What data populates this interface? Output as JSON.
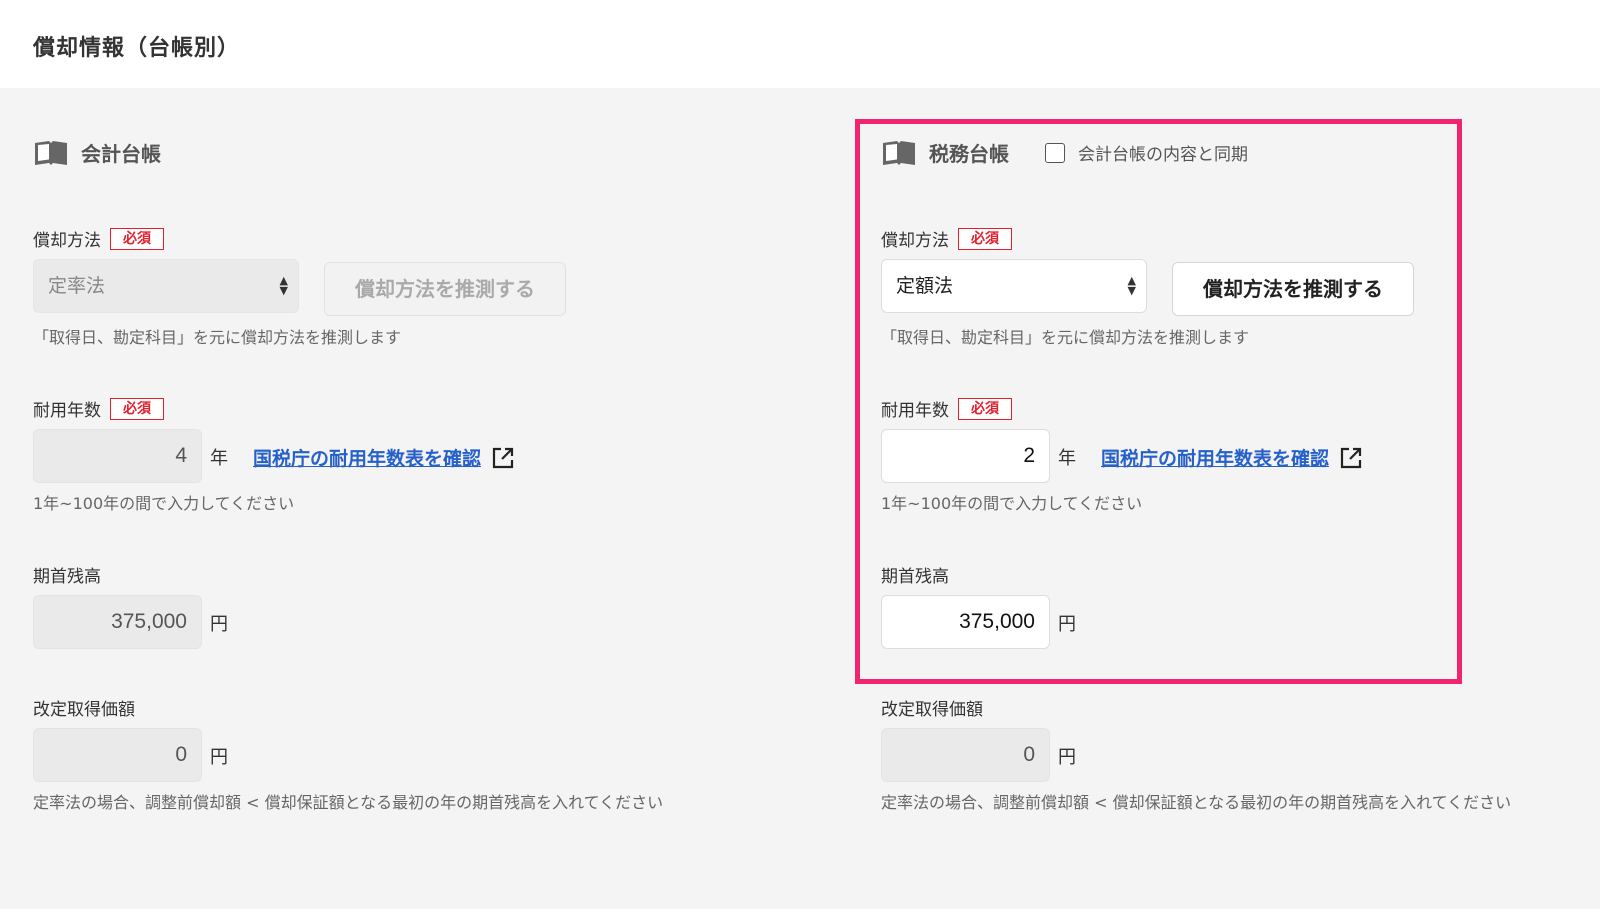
{
  "header": {
    "title": "償却情報（台帳別）"
  },
  "accounting": {
    "title": "会計台帳",
    "method_label": "償却方法",
    "required_badge": "必須",
    "method_value": "定率法",
    "estimate_button": "償却方法を推測する",
    "method_hint": "「取得日、勘定科目」を元に償却方法を推測します",
    "life_label": "耐用年数",
    "life_value": "4",
    "life_unit": "年",
    "life_link": "国税庁の耐用年数表を確認",
    "life_hint": "1年~100年の間で入力してください",
    "opening_label": "期首残高",
    "opening_value": "375,000",
    "yen_unit": "円",
    "revised_label": "改定取得価額",
    "revised_value": "0",
    "revised_hint": "定率法の場合、調整前償却額 < 償却保証額となる最初の年の期首残高を入れてください"
  },
  "tax": {
    "title": "税務台帳",
    "sync_label": "会計台帳の内容と同期",
    "method_label": "償却方法",
    "required_badge": "必須",
    "method_value": "定額法",
    "estimate_button": "償却方法を推測する",
    "method_hint": "「取得日、勘定科目」を元に償却方法を推測します",
    "life_label": "耐用年数",
    "life_value": "2",
    "life_unit": "年",
    "life_link": "国税庁の耐用年数表を確認",
    "life_hint": "1年~100年の間で入力してください",
    "opening_label": "期首残高",
    "opening_value": "375,000",
    "yen_unit": "円",
    "revised_label": "改定取得価額",
    "revised_value": "0",
    "revised_hint": "定率法の場合、調整前償却額 < 償却保証額となる最初の年の期首残高を入れてください"
  },
  "colors": {
    "required": "#e5202e",
    "link": "#2660c9",
    "highlight": "#f0246f"
  }
}
